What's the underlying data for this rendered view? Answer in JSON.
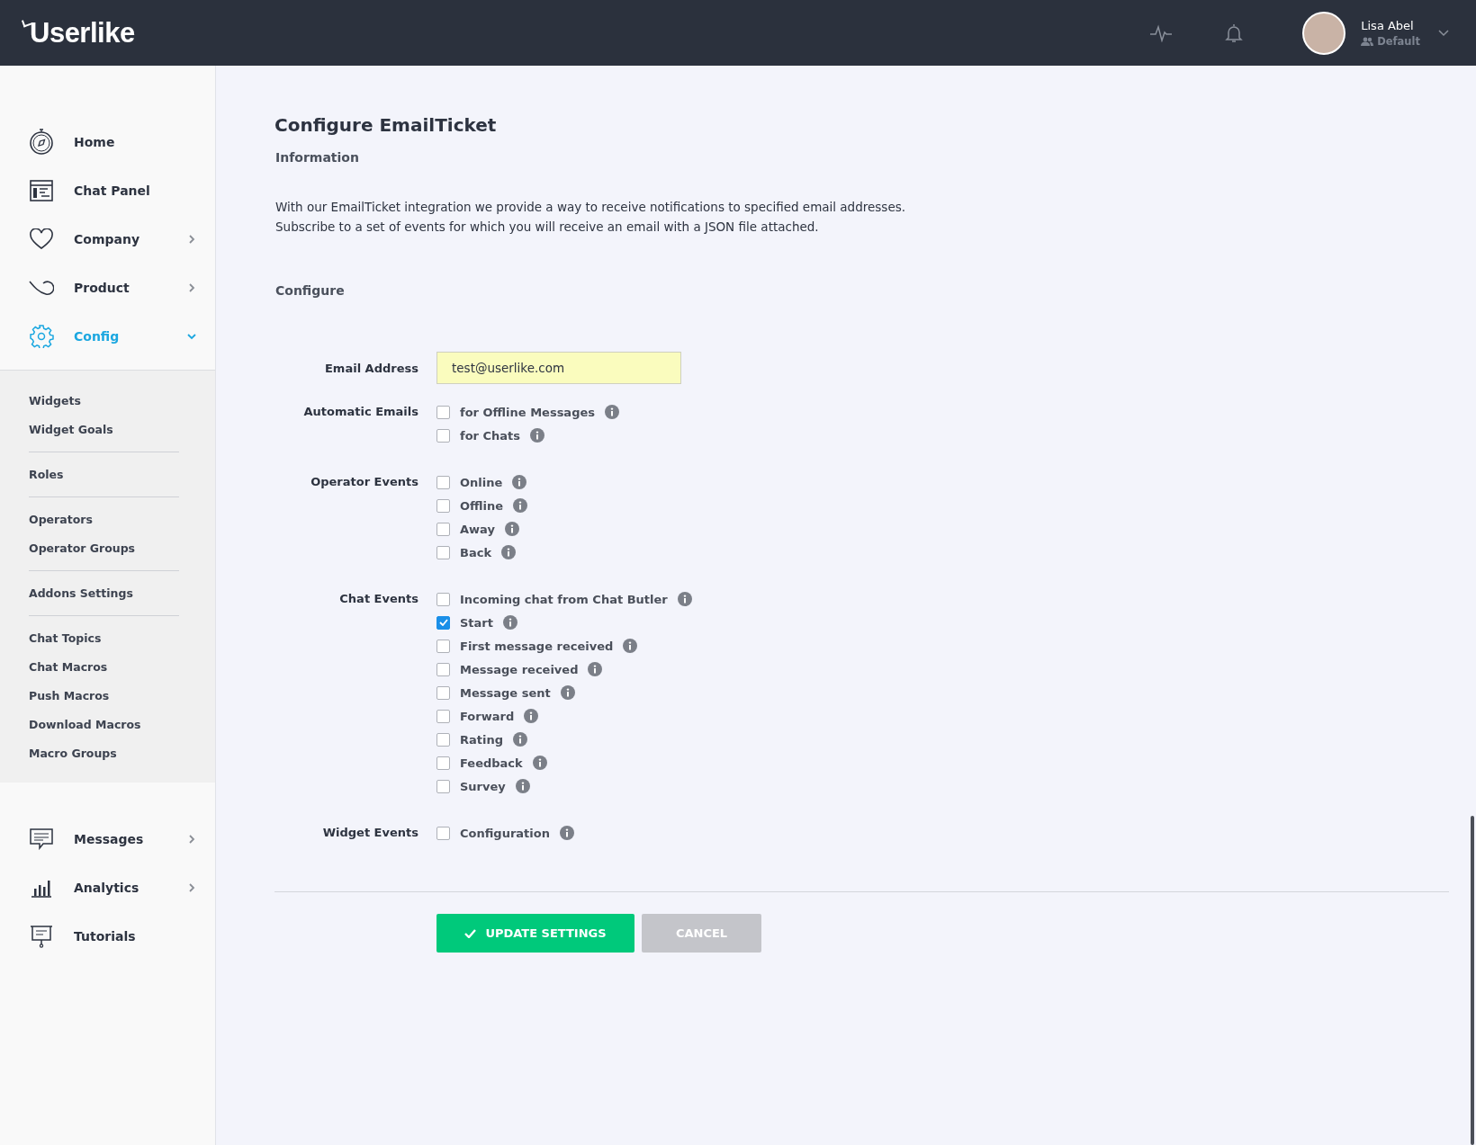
{
  "header": {
    "logo": "Userlike",
    "user": {
      "name": "Lisa Abel",
      "group": "Default"
    }
  },
  "sidebar": {
    "items": [
      {
        "label": "Home",
        "kind": "link",
        "selected": false
      },
      {
        "label": "Chat Panel",
        "kind": "link",
        "selected": false
      },
      {
        "label": "Company",
        "kind": "group",
        "selected": false,
        "expanded": false
      },
      {
        "label": "Product",
        "kind": "group",
        "selected": false,
        "expanded": false
      },
      {
        "label": "Config",
        "kind": "group",
        "selected": true,
        "expanded": true,
        "children": [
          [
            "Widgets",
            "Widget Goals"
          ],
          [
            "Roles"
          ],
          [
            "Operators",
            "Operator Groups"
          ],
          [
            "Addons Settings"
          ],
          [
            "Chat Topics",
            "Chat Macros",
            "Push Macros",
            "Download Macros",
            "Macro Groups"
          ]
        ]
      },
      {
        "label": "Messages",
        "kind": "group",
        "selected": false,
        "expanded": false
      },
      {
        "label": "Analytics",
        "kind": "group",
        "selected": false,
        "expanded": false
      },
      {
        "label": "Tutorials",
        "kind": "link",
        "selected": false
      }
    ]
  },
  "page": {
    "title": "Configure EmailTicket",
    "info_heading": "Information",
    "description": [
      "With our EmailTicket integration we provide a way to receive notifications to specified email addresses.",
      "Subscribe to a set of events for which you will receive an email with a JSON file attached."
    ],
    "configure_heading": "Configure",
    "email": {
      "label": "Email Address",
      "value": "test@userlike.com"
    },
    "groups": [
      {
        "label": "Automatic Emails",
        "options": [
          {
            "label": "for Offline Messages",
            "checked": false
          },
          {
            "label": "for Chats",
            "checked": false
          }
        ]
      },
      {
        "label": "Operator Events",
        "options": [
          {
            "label": "Online",
            "checked": false
          },
          {
            "label": "Offline",
            "checked": false
          },
          {
            "label": "Away",
            "checked": false
          },
          {
            "label": "Back",
            "checked": false
          }
        ]
      },
      {
        "label": "Chat Events",
        "options": [
          {
            "label": "Incoming chat from Chat Butler",
            "checked": false
          },
          {
            "label": "Start",
            "checked": true
          },
          {
            "label": "First message received",
            "checked": false
          },
          {
            "label": "Message received",
            "checked": false
          },
          {
            "label": "Message sent",
            "checked": false
          },
          {
            "label": "Forward",
            "checked": false
          },
          {
            "label": "Rating",
            "checked": false
          },
          {
            "label": "Feedback",
            "checked": false
          },
          {
            "label": "Survey",
            "checked": false
          }
        ]
      },
      {
        "label": "Widget Events",
        "options": [
          {
            "label": "Configuration",
            "checked": false
          }
        ]
      }
    ],
    "buttons": {
      "primary": "UPDATE SETTINGS",
      "secondary": "CANCEL"
    }
  }
}
